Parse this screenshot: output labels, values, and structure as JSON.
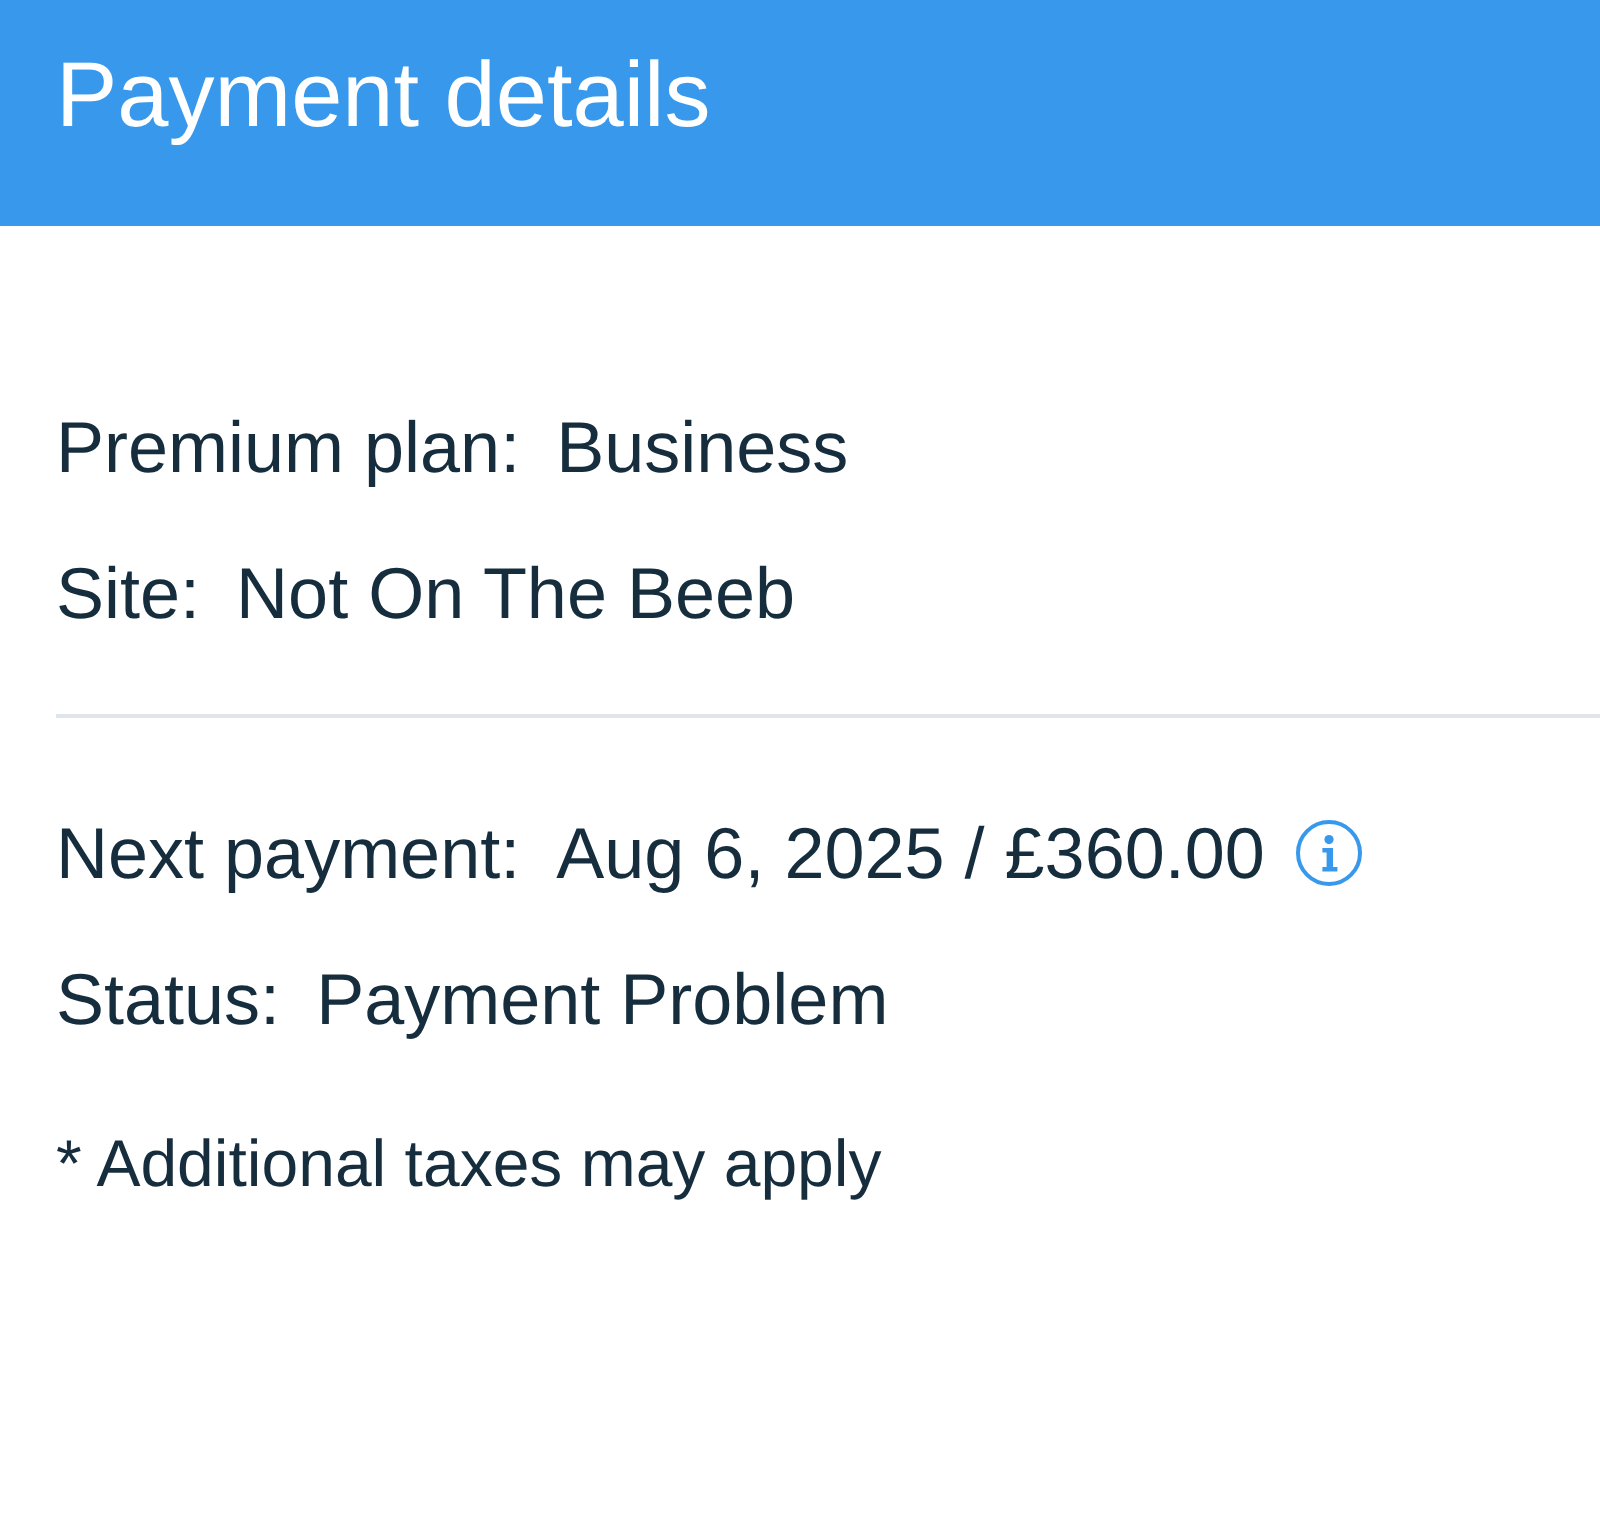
{
  "header": {
    "title": "Payment details"
  },
  "plan_section": {
    "rows": [
      {
        "label": "Premium plan:",
        "value": "Business",
        "info": false
      },
      {
        "label": "Site:",
        "value": "Not On The Beeb",
        "info": false
      }
    ]
  },
  "payment_section": {
    "rows": [
      {
        "label": "Next payment:",
        "value": "Aug 6, 2025 / £360.00",
        "info": true
      },
      {
        "label": "Status:",
        "value": "Payment Problem",
        "info": false
      }
    ]
  },
  "footnote": "* Additional taxes may apply"
}
